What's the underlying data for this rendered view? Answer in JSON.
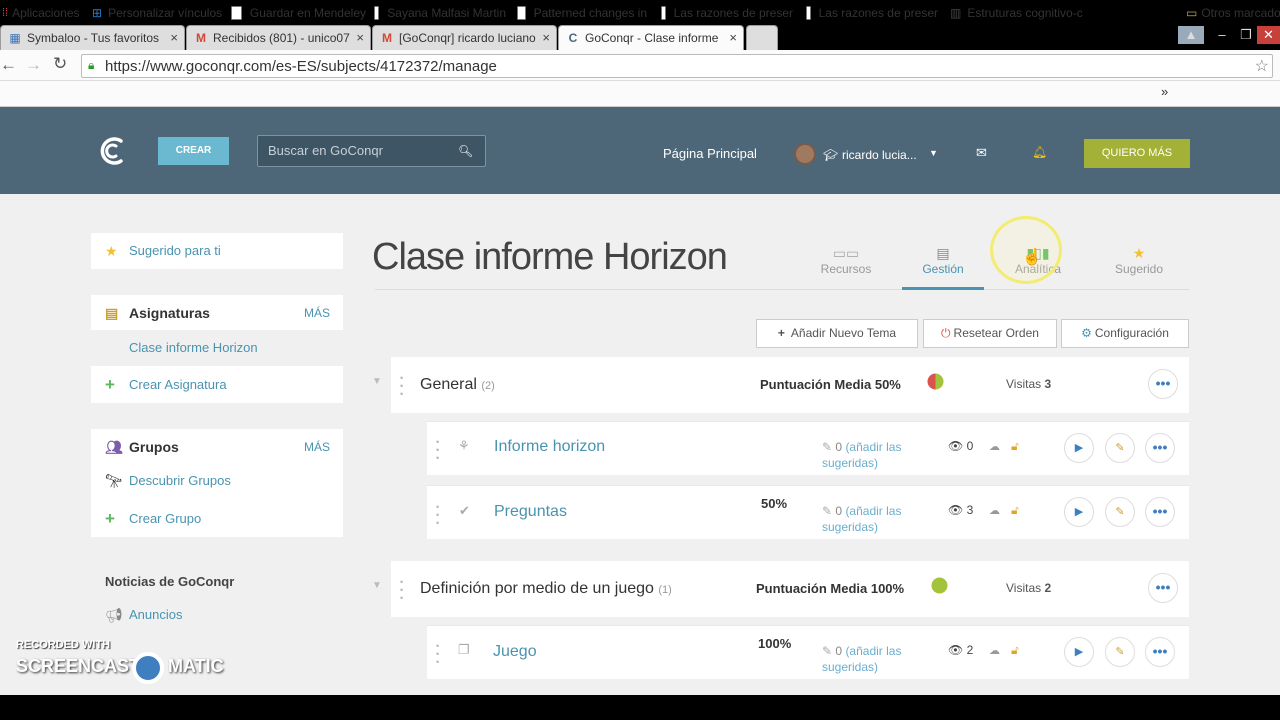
{
  "browser": {
    "tabs": [
      {
        "title": "Symbaloo - Tus favoritos",
        "icon": "symbaloo-icon"
      },
      {
        "title": "Recibidos (801) - unico07",
        "icon": "gmail-icon"
      },
      {
        "title": "[GoConqr] ricardo luciano",
        "icon": "gmail-icon"
      },
      {
        "title": "GoConqr - Clase informe",
        "icon": "goconqr-icon"
      }
    ],
    "url": "https://www.goconqr.com/es-ES/subjects/4172372/manage",
    "bookmarks": [
      "Aplicaciones",
      "Personalizar vínculos",
      "Guardar en Mendeley",
      "Sayana Malfasi Martin",
      "Patterned changes in",
      "Las razones de preser",
      "Las razones de preser",
      "Estruturas cognitivo-c"
    ],
    "bookmarks_more": "»",
    "other_bookmarks": "Otros marcadores"
  },
  "header": {
    "crear": "CREAR",
    "search_placeholder": "Buscar en GoConqr",
    "home": "Página Principal",
    "user": "ricardo lucia...",
    "quiero": "QUIERO MÁS"
  },
  "sidebar": {
    "suggested": "Sugerido para ti",
    "subjects_title": "Asignaturas",
    "subjects_more": "MÁS",
    "current_subject": "Clase informe Horizon",
    "create_subject": "Crear Asignatura",
    "groups_title": "Grupos",
    "groups_more": "MÁS",
    "discover_groups": "Descubrir Grupos",
    "create_group": "Crear Grupo",
    "news_title": "Noticias de GoConqr",
    "announcements": "Anuncios"
  },
  "main": {
    "title": "Clase informe Horizon",
    "tabs": [
      {
        "label": "Recursos",
        "icon": "resources-icon"
      },
      {
        "label": "Gestión",
        "icon": "management-icon"
      },
      {
        "label": "Analítica",
        "icon": "analytics-icon"
      },
      {
        "label": "Sugerido",
        "icon": "star-icon"
      }
    ],
    "active_tab": "Gestión",
    "buttons": {
      "add_topic": "Añadir Nuevo Tema",
      "reset_order": "Resetear Orden",
      "config": "Configuración"
    },
    "topics": [
      {
        "name": "General",
        "count": "(2)",
        "score_label": "Puntuación Media 50%",
        "visits_label": "Visitas",
        "visits": "3",
        "score": 0.5,
        "lessons": [
          {
            "name": "Informe horizon",
            "percent": "",
            "suggested_count": "0",
            "suggested_link": "(añadir las sugeridas)",
            "views": "0",
            "icon": "mindmap-icon"
          },
          {
            "name": "Preguntas",
            "percent": "50%",
            "suggested_count": "0",
            "suggested_link": "(añadir las sugeridas)",
            "views": "3",
            "icon": "quiz-icon"
          }
        ]
      },
      {
        "name": "Definición por medio de un juego",
        "count": "(1)",
        "score_label": "Puntuación Media 100%",
        "visits_label": "Visitas",
        "visits": "2",
        "score": 1.0,
        "lessons": [
          {
            "name": "Juego",
            "percent": "100%",
            "suggested_count": "0",
            "suggested_link": "(añadir las sugeridas)",
            "views": "2",
            "icon": "flashcard-icon"
          }
        ]
      }
    ]
  },
  "watermark": {
    "line1": "RECORDED WITH",
    "line2": "SCREENCAST",
    "line3": "MATIC"
  },
  "colors": {
    "header": "#4d6778",
    "crear": "#6ab9d0",
    "quiero": "#a3b236",
    "link": "#4a93b0",
    "active_tab": "#4a93b0"
  }
}
